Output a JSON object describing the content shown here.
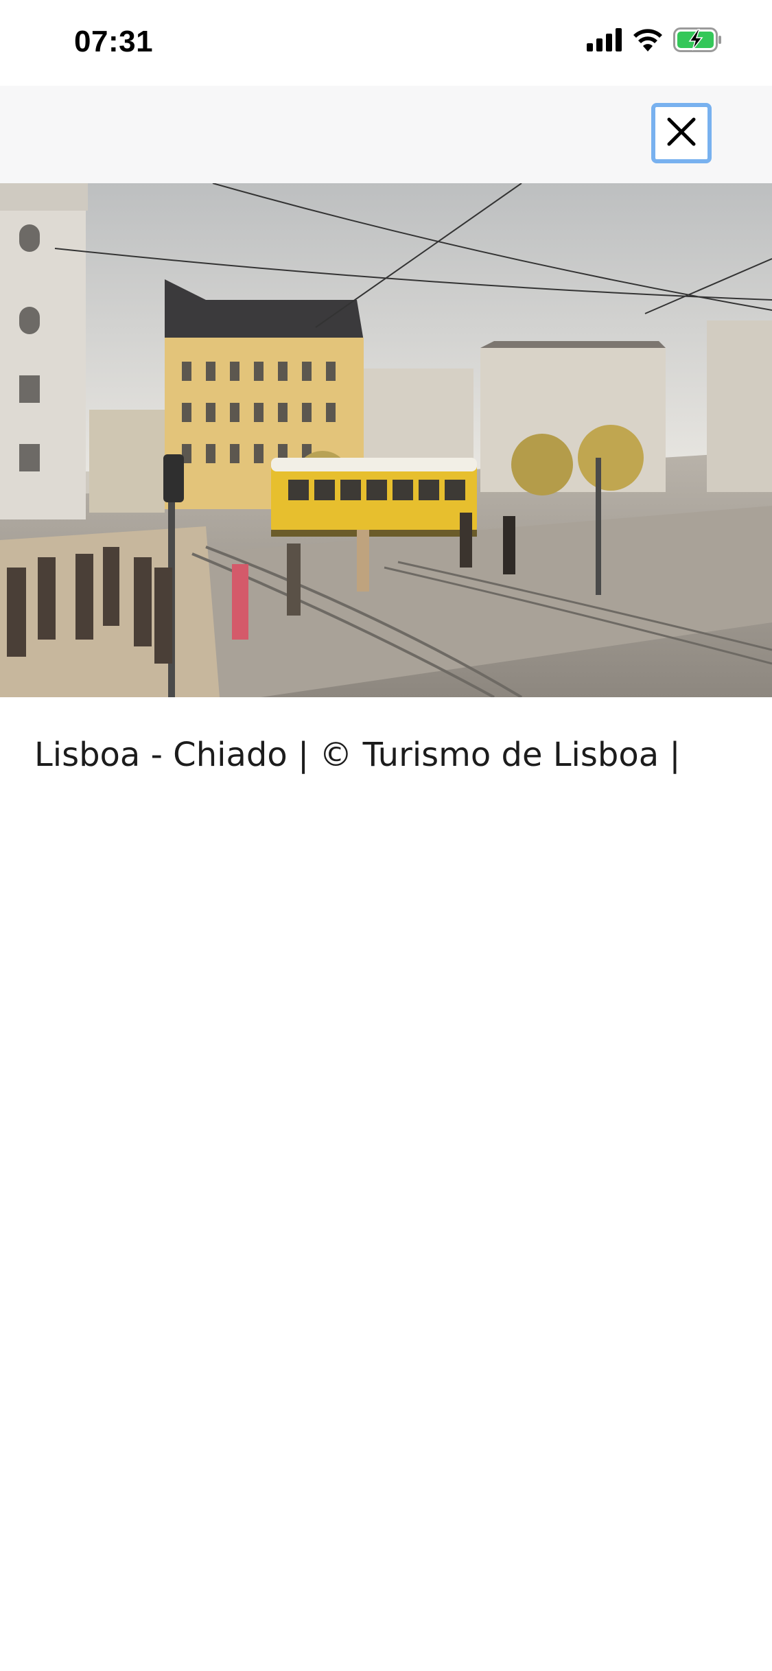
{
  "status_bar": {
    "time": "07:31",
    "icons": [
      "cellular-signal-icon",
      "wifi-icon",
      "battery-charging-icon"
    ],
    "battery_color": "#34c759"
  },
  "toolbar": {
    "close_icon": "close-icon",
    "close_focus_color": "#78b1ef"
  },
  "photo": {
    "subject": "Lisboa - Chiado street scene with yellow tram"
  },
  "caption": {
    "text": "Lisboa - Chiado | © Turismo de Lisboa |"
  }
}
